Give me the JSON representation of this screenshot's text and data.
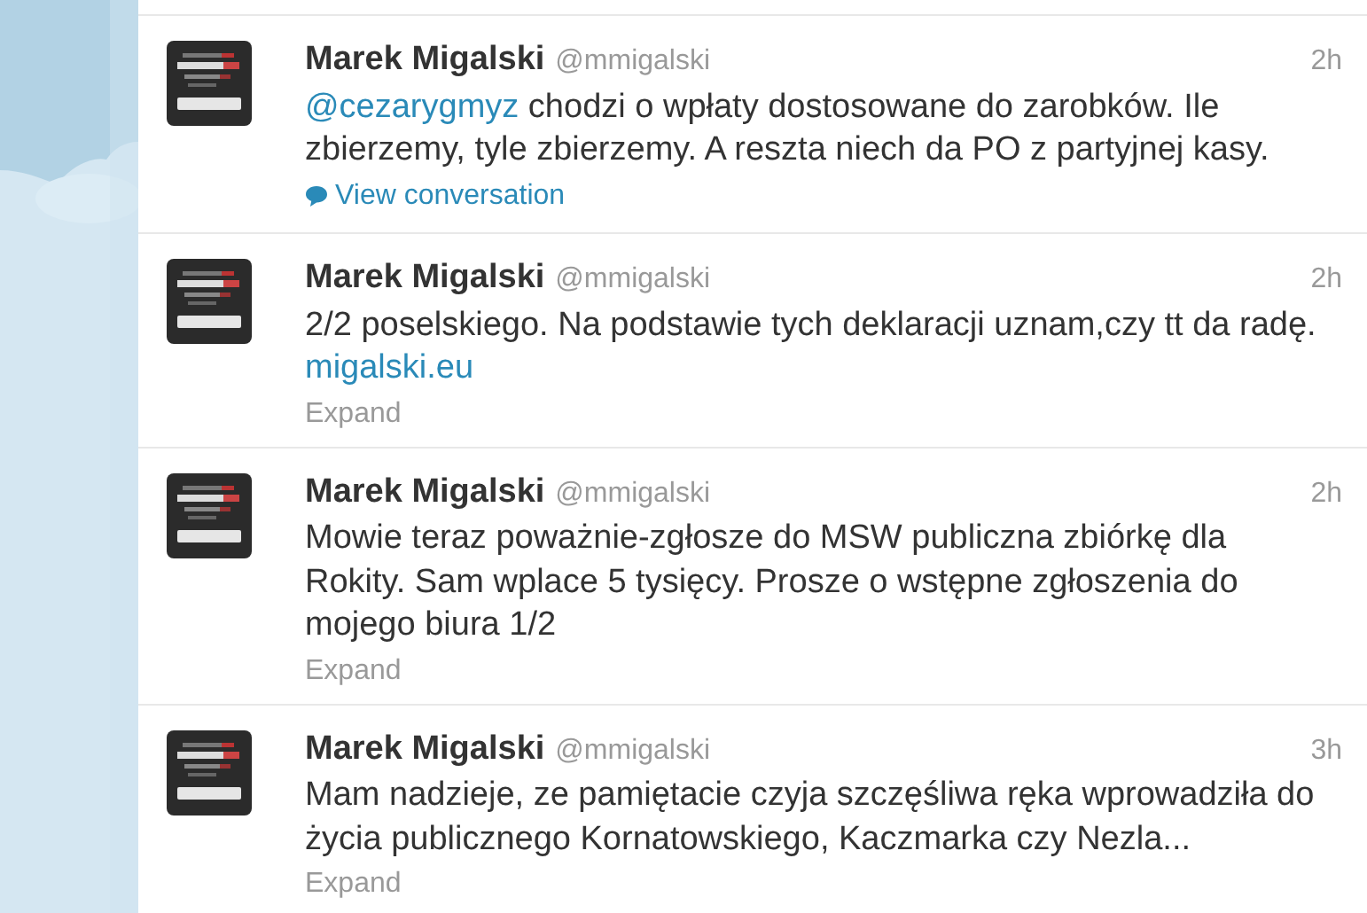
{
  "tweets": [
    {
      "name": "Marek Migalski",
      "handle": "@mmigalski",
      "time": "2h",
      "text": [
        {
          "kind": "link",
          "text": "@cezarygmyz"
        },
        {
          "kind": "plain",
          "text": " chodzi o wpłaty dostosowane do zarobków. Ile zbierzemy, tyle zbierzemy. A reszta niech da PO z partyjnej kasy."
        }
      ],
      "action": {
        "kind": "conversation",
        "label": "View conversation"
      }
    },
    {
      "name": "Marek Migalski",
      "handle": "@mmigalski",
      "time": "2h",
      "text": [
        {
          "kind": "plain",
          "text": "2/2 poselskiego. Na podstawie tych deklaracji uznam,czy tt da radę. "
        },
        {
          "kind": "link",
          "text": "migalski.eu"
        }
      ],
      "action": {
        "kind": "expand",
        "label": "Expand"
      }
    },
    {
      "name": "Marek Migalski",
      "handle": "@mmigalski",
      "time": "2h",
      "text": [
        {
          "kind": "plain",
          "text": "Mowie teraz poważnie-zgłosze do MSW publiczna zbiórkę dla Rokity. Sam wplace 5 tysięcy. Prosze o wstępne zgłoszenia do mojego biura 1/2"
        }
      ],
      "action": {
        "kind": "expand",
        "label": "Expand"
      }
    },
    {
      "name": "Marek Migalski",
      "handle": "@mmigalski",
      "time": "3h",
      "text": [
        {
          "kind": "plain",
          "text": "Mam nadzieje, ze pamiętacie czyja szczęśliwa ręka wprowadziła do życia publicznego Kornatowskiego, Kaczmarka czy Nezla..."
        }
      ],
      "action": {
        "kind": "expand",
        "label": "Expand"
      }
    }
  ]
}
